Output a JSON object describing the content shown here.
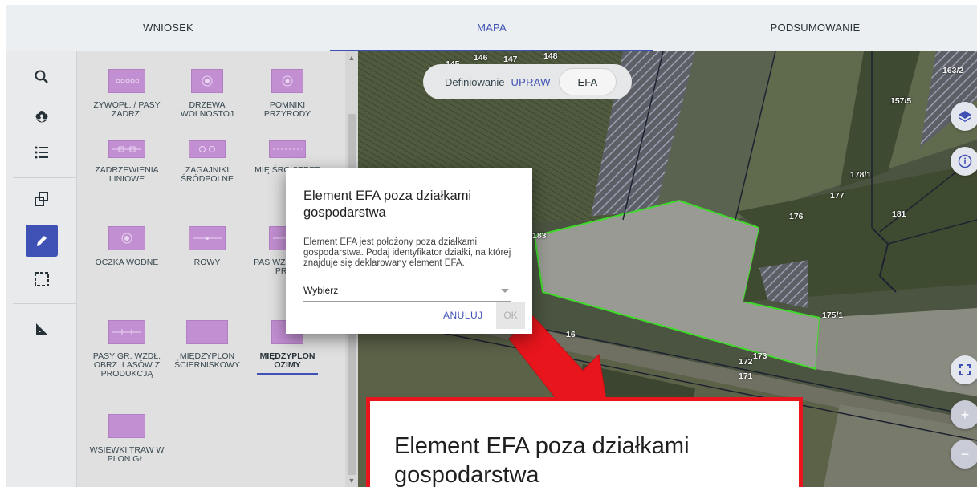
{
  "tabs": [
    {
      "label": "WNIOSEK",
      "active": false
    },
    {
      "label": "MAPA",
      "active": true
    },
    {
      "label": "PODSUMOWANIE",
      "active": false
    }
  ],
  "toolbar": {
    "tools": [
      {
        "icon": "search-icon"
      },
      {
        "icon": "flower-icon"
      },
      {
        "icon": "list-icon"
      },
      {
        "icon": "copy-icon"
      },
      {
        "icon": "pencil-icon",
        "active": true
      },
      {
        "icon": "select-area-icon"
      },
      {
        "icon": "measure-icon"
      }
    ]
  },
  "palette": {
    "items": [
      {
        "label": "ŻYWOPŁ. / PASY ZADRZ."
      },
      {
        "label": "DRZEWA WOLNOSTOJ"
      },
      {
        "label": "POMNIKI PRZYRODY"
      },
      {
        "label": "ZADRZEWIENIA LINIOWE"
      },
      {
        "label": "ZAGAJNIKI ŚRÓDPOLNE"
      },
      {
        "label": "MIĘ ŚRO STREF"
      },
      {
        "label": "OCZKA WODNE"
      },
      {
        "label": "ROWY"
      },
      {
        "label": "PAS WZDŁ LASÓ PROD"
      },
      {
        "label": "PASY GR. WZDŁ. OBRZ. LASÓW Z PRODUKCJĄ"
      },
      {
        "label": "MIĘDZYPLON ŚCIERNISKOWY"
      },
      {
        "label": "MIĘDZYPLON OZIMY",
        "selected": true
      },
      {
        "label": "WSIEWKI TRAW W PLON GŁ."
      }
    ]
  },
  "define": {
    "label": "Definiowanie",
    "upraw": "UPRAW",
    "efa": "EFA"
  },
  "map_labels": [
    "145",
    "146",
    "147",
    "148",
    "163/2",
    "157/5",
    "178/1",
    "177",
    "176",
    "181",
    "183",
    "175/1",
    "16",
    "172",
    "173",
    "171"
  ],
  "dialog": {
    "title": "Element EFA poza działkami gospodarstwa",
    "message": "Element EFA jest położony poza działkami gospodarstwa. Podaj identyfikator działki, na której znajduje się deklarowany element EFA.",
    "select_value": "Wybierz",
    "cancel_label": "ANULUJ",
    "ok_label": "OK"
  },
  "callout": {
    "text": "Element EFA poza działkami gospodarstwa"
  },
  "colors": {
    "accent": "#3f51b5",
    "callout_border": "#e8151c",
    "arrow": "#e8151c",
    "efa_item": "#c38fd3",
    "parcel_outline": "#3edb2a"
  }
}
